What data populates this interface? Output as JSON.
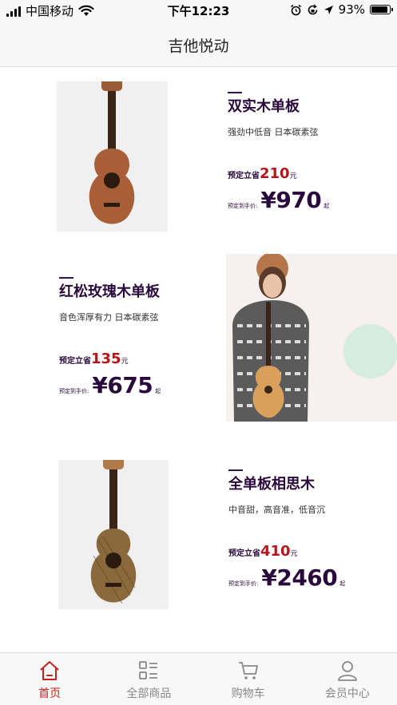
{
  "status_bar": {
    "carrier": "中国移动",
    "time": "下午12:23",
    "battery": "93%",
    "battery_level": 0.93
  },
  "nav": {
    "title": "吉他悦动"
  },
  "products": [
    {
      "title": "双实木单板",
      "subtitle": "强劲中低音  日本碳素弦",
      "save_label": "预定立省",
      "save_amount": "210",
      "save_unit": "元",
      "price_label": "预定到手价:",
      "price": "¥970",
      "price_suffix": "起",
      "image_icon": "ukulele-icon"
    },
    {
      "title": "红松玫瑰木单板",
      "subtitle": "音色浑厚有力  日本碳素弦",
      "save_label": "预定立省",
      "save_amount": "135",
      "save_unit": "元",
      "price_label": "预定到手价:",
      "price": "¥675",
      "price_suffix": "起",
      "image_icon": "model-with-ukulele"
    },
    {
      "title": "全单板相思木",
      "subtitle": "中音甜，高音准，低音沉",
      "save_label": "预定立省",
      "save_amount": "410",
      "save_unit": "元",
      "price_label": "预定到手价:",
      "price": "¥2460",
      "price_suffix": "起",
      "image_icon": "ukulele-icon"
    }
  ],
  "tab_bar": {
    "items": [
      {
        "label": "首页",
        "icon": "home-icon",
        "active": true
      },
      {
        "label": "全部商品",
        "icon": "category-icon",
        "active": false
      },
      {
        "label": "购物车",
        "icon": "cart-icon",
        "active": false
      },
      {
        "label": "会员中心",
        "icon": "user-icon",
        "active": false
      }
    ]
  },
  "colors": {
    "accent": "#c9211e",
    "price_red": "#b8141b",
    "title_purple": "#2a0a3c",
    "tab_inactive": "#888888"
  }
}
